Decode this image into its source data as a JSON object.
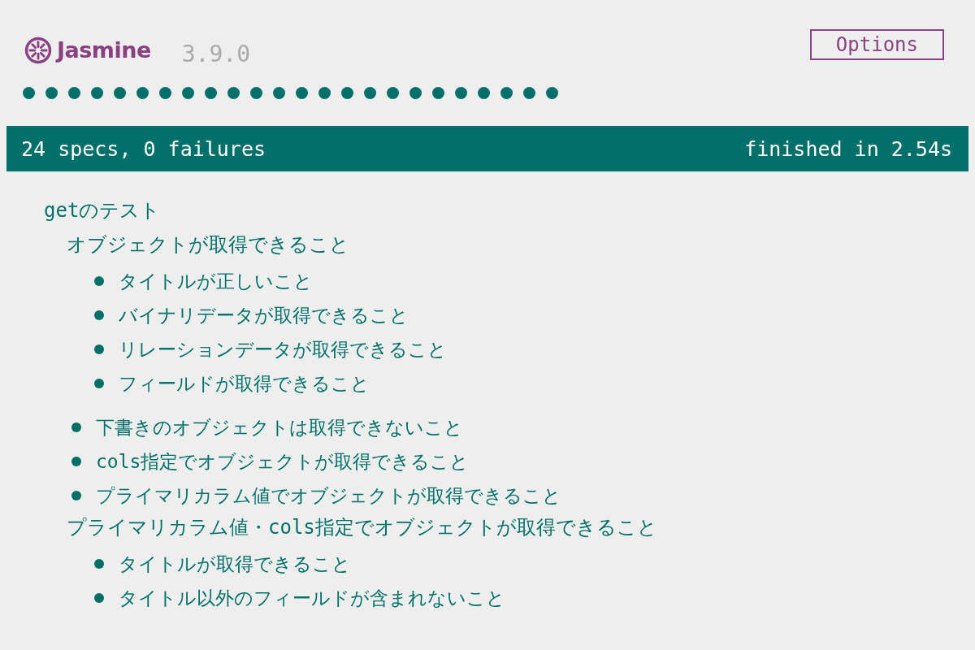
{
  "header": {
    "title": "Jasmine",
    "version": "3.9.0",
    "options_button": "Options"
  },
  "dots": [
    {
      "passed": true
    },
    {
      "passed": true
    },
    {
      "passed": true
    },
    {
      "passed": true
    },
    {
      "passed": true
    },
    {
      "passed": true
    },
    {
      "passed": true
    },
    {
      "passed": true
    },
    {
      "passed": true
    },
    {
      "passed": true
    },
    {
      "passed": true
    },
    {
      "passed": true
    },
    {
      "passed": true
    },
    {
      "passed": true
    },
    {
      "passed": true
    },
    {
      "passed": true
    },
    {
      "passed": true
    },
    {
      "passed": true
    },
    {
      "passed": true
    },
    {
      "passed": true
    },
    {
      "passed": true
    },
    {
      "passed": true
    },
    {
      "passed": true
    },
    {
      "passed": true
    }
  ],
  "summary": {
    "passed": true,
    "text": "24 specs, 0 failures",
    "duration": "finished in 2.54s"
  },
  "results": [
    {
      "kind": "suite",
      "name": "getのテスト",
      "children": [
        {
          "kind": "suite",
          "name": "オブジェクトが取得できること",
          "children": [
            {
              "kind": "spec",
              "name": "タイトルが正しいこと",
              "passed": true
            },
            {
              "kind": "spec",
              "name": "バイナリデータが取得できること",
              "passed": true
            },
            {
              "kind": "spec",
              "name": "リレーションデータが取得できること",
              "passed": true
            },
            {
              "kind": "spec",
              "name": "フィールドが取得できること",
              "passed": true
            }
          ]
        },
        {
          "kind": "spec",
          "name": "下書きのオブジェクトは取得できないこと",
          "passed": true
        },
        {
          "kind": "spec",
          "name": "cols指定でオブジェクトが取得できること",
          "passed": true
        },
        {
          "kind": "spec",
          "name": "プライマリカラム値でオブジェクトが取得できること",
          "passed": true
        },
        {
          "kind": "suite",
          "name": "プライマリカラム値・cols指定でオブジェクトが取得できること",
          "children": [
            {
              "kind": "spec",
              "name": "タイトルが取得できること",
              "passed": true
            },
            {
              "kind": "spec",
              "name": "タイトル以外のフィールドが含まれないこと",
              "passed": true
            }
          ]
        }
      ]
    }
  ]
}
